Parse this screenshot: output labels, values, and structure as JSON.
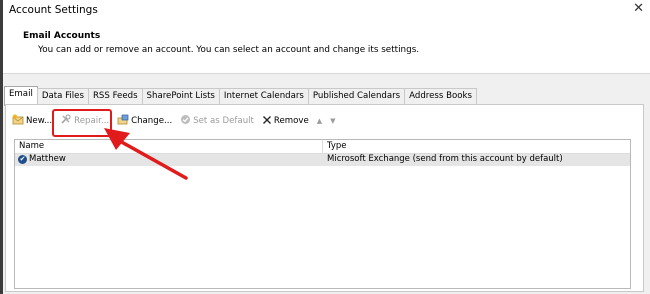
{
  "window": {
    "title": "Account Settings",
    "close_glyph": "✕"
  },
  "header": {
    "title": "Email Accounts",
    "description": "You can add or remove an account. You can select an account and change its settings."
  },
  "tabs": [
    {
      "label": "Email"
    },
    {
      "label": "Data Files"
    },
    {
      "label": "RSS Feeds"
    },
    {
      "label": "SharePoint Lists"
    },
    {
      "label": "Internet Calendars"
    },
    {
      "label": "Published Calendars"
    },
    {
      "label": "Address Books"
    }
  ],
  "toolbar": {
    "new_label": "New...",
    "repair_label": "Repair...",
    "change_label": "Change...",
    "set_default_label": "Set as Default",
    "remove_label": "Remove"
  },
  "list": {
    "columns": {
      "name": "Name",
      "type": "Type"
    },
    "rows": [
      {
        "name": "Matthew",
        "type": "Microsoft Exchange (send from this account by default)"
      }
    ]
  },
  "colors": {
    "highlight": "#e11b1b",
    "selected_row": "#e5e5e5",
    "default_account": "#1f4e8c"
  }
}
